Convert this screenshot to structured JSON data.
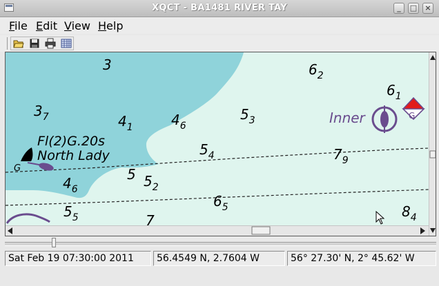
{
  "window": {
    "title": "XQCT - BA1481 RIVER TAY"
  },
  "menu": {
    "items": [
      {
        "label": "File",
        "mnemonic": "F",
        "rest": "ile"
      },
      {
        "label": "Edit",
        "mnemonic": "E",
        "rest": "dit"
      },
      {
        "label": "View",
        "mnemonic": "V",
        "rest": "iew"
      },
      {
        "label": "Help",
        "mnemonic": "H",
        "rest": "elp"
      }
    ]
  },
  "toolbar": {
    "buttons": [
      "open-folder-icon",
      "save-icon",
      "print-icon",
      "grid-icon"
    ]
  },
  "chart": {
    "colors": {
      "land": "#8fd3da",
      "shallow": "#dff5ee",
      "deep": "#ffffff",
      "symbol": "#6a4c8e",
      "buoy": "#e21b1b"
    },
    "soundings": [
      {
        "main": "3",
        "sub": ""
      },
      {
        "main": "6",
        "sub": "2"
      },
      {
        "main": "6",
        "sub": "1"
      },
      {
        "main": "3",
        "sub": "7"
      },
      {
        "main": "4",
        "sub": "1"
      },
      {
        "main": "4",
        "sub": "6"
      },
      {
        "main": "5",
        "sub": "3"
      },
      {
        "main": "5",
        "sub": "4"
      },
      {
        "main": "7",
        "sub": "9"
      },
      {
        "main": "5",
        "sub": ""
      },
      {
        "main": "5",
        "sub": "2"
      },
      {
        "main": "4",
        "sub": "6"
      },
      {
        "main": "6",
        "sub": "5"
      },
      {
        "main": "5",
        "sub": "5"
      },
      {
        "main": "8",
        "sub": "4"
      },
      {
        "main": "7",
        "sub": ""
      }
    ],
    "light_label": "Fl(2)G.20s",
    "buoy_name": "North Lady",
    "buoy_letter": "G",
    "inner_label": "Inner",
    "beacon_letter": "G"
  },
  "time_slider": {
    "position": 0.11
  },
  "status": {
    "datetime": "Sat Feb 19 07:30:00 2011",
    "decimal_position": "56.4549 N,   2.7604 W",
    "dms_position": "56° 27.30' N, 2° 45.62' W"
  }
}
